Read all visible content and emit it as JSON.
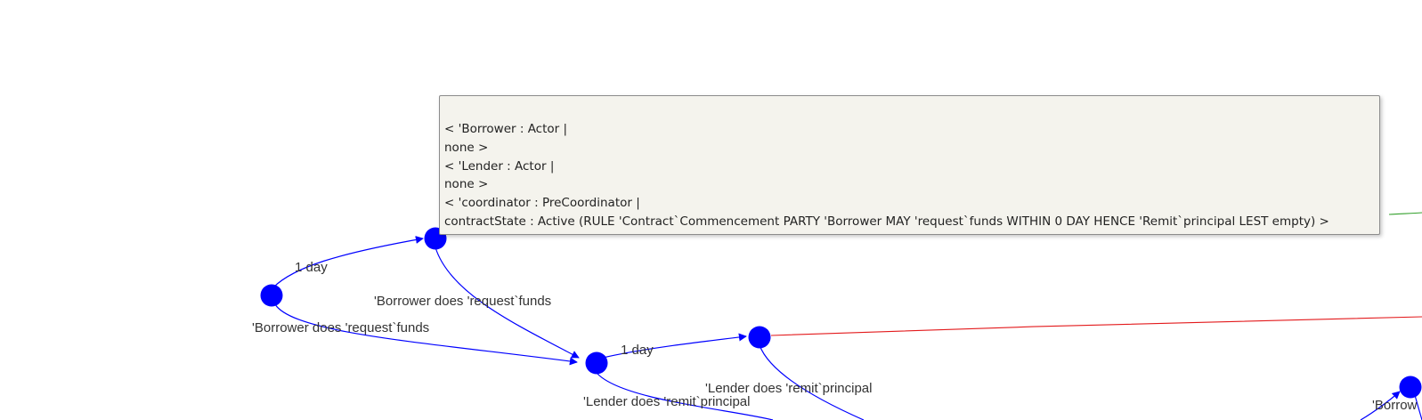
{
  "colors": {
    "node": "#0000ff",
    "edge_default": "#0000ff",
    "edge_red": "#e31a1c",
    "edge_green": "#33a02c",
    "tooltip_bg": "#f4f3ed",
    "tooltip_border": "#8c8c8c"
  },
  "edge_labels": {
    "n1_to_n2": "1 day",
    "n1_to_n3": "'Borrower does 'request`funds",
    "n2_to_n3": "'Borrower does 'request`funds",
    "n3_to_n4": "1 day",
    "n3_to_bottom": "'Lender does 'remit`principal",
    "n4_to_bottom": "'Lender does 'remit`principal",
    "n5_partial": "'Borrow"
  },
  "tooltip": {
    "lines": [
      "< 'Borrower : Actor |",
      "none >",
      "< 'Lender : Actor |",
      "none >",
      "< 'coordinator : PreCoordinator |",
      "contractState : Active (RULE 'Contract`Commencement PARTY 'Borrower MAY 'request`funds WITHIN 0 DAY HENCE 'Remit`principal LEST empty) >"
    ]
  }
}
